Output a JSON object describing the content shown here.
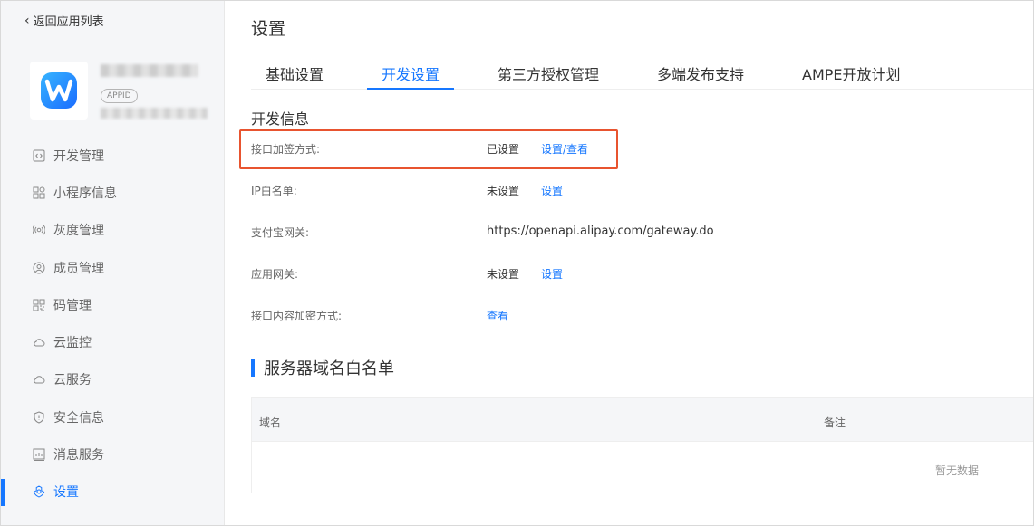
{
  "sidebar": {
    "back_label": "返回应用列表",
    "app": {
      "appid_badge": "APPID",
      "logo_letter": "W"
    },
    "items": [
      {
        "label": "开发管理",
        "icon": "code-icon"
      },
      {
        "label": "小程序信息",
        "icon": "grid-icon"
      },
      {
        "label": "灰度管理",
        "icon": "broadcast-icon"
      },
      {
        "label": "成员管理",
        "icon": "user-circle-icon"
      },
      {
        "label": "码管理",
        "icon": "qrcode-icon"
      },
      {
        "label": "云监控",
        "icon": "cloud-icon"
      },
      {
        "label": "云服务",
        "icon": "cloud-icon"
      },
      {
        "label": "安全信息",
        "icon": "shield-icon"
      },
      {
        "label": "消息服务",
        "icon": "chart-icon"
      },
      {
        "label": "设置",
        "icon": "gear-icon",
        "active": true
      }
    ]
  },
  "main": {
    "page_title": "设置",
    "tabs": [
      {
        "label": "基础设置"
      },
      {
        "label": "开发设置",
        "active": true
      },
      {
        "label": "第三方授权管理"
      },
      {
        "label": "多端发布支持"
      },
      {
        "label": "AMPE开放计划"
      }
    ],
    "dev_info": {
      "title": "开发信息",
      "rows": [
        {
          "label": "接口加签方式:",
          "status": "已设置",
          "link": "设置/查看"
        },
        {
          "label": "IP白名单:",
          "status": "未设置",
          "link": "设置"
        },
        {
          "label": "支付宝网关:",
          "value": "https://openapi.alipay.com/gateway.do"
        },
        {
          "label": "应用网关:",
          "status": "未设置",
          "link": "设置"
        },
        {
          "label": "接口内容加密方式:",
          "link": "查看"
        }
      ]
    },
    "server_whitelist": {
      "title": "服务器域名白名单",
      "columns": [
        "域名",
        "备注"
      ],
      "empty_text": "暂无数据"
    }
  },
  "colors": {
    "accent": "#1677ff",
    "highlight": "#e8542f"
  }
}
